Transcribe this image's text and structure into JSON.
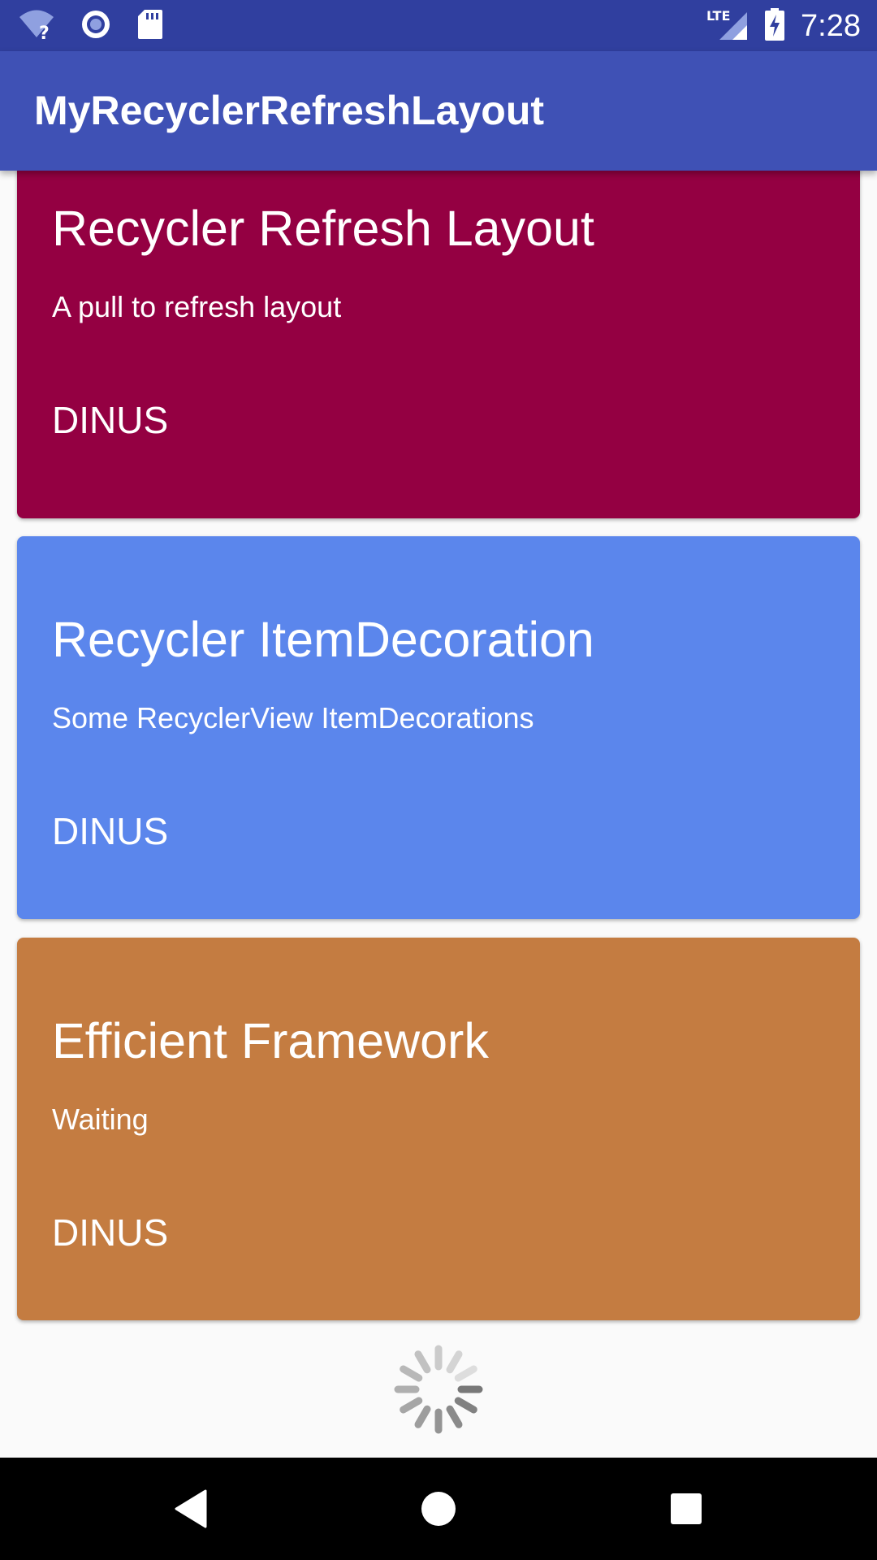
{
  "status_bar": {
    "time": "7:28",
    "icons": [
      "wifi-unknown-icon",
      "sync-icon",
      "sd-card-icon",
      "lte-signal-icon",
      "battery-charging-icon"
    ],
    "network_label": "LTE"
  },
  "app_bar": {
    "title": "MyRecyclerRefreshLayout",
    "color": "#3f51b5"
  },
  "cards": [
    {
      "title": "Recycler Refresh Layout",
      "subtitle": "A pull to refresh layout",
      "author": "DINUS",
      "color": "#940042"
    },
    {
      "title": "Recycler ItemDecoration",
      "subtitle": "Some RecyclerView ItemDecorations",
      "author": "DINUS",
      "color": "#5b86ec"
    },
    {
      "title": "Efficient Framework",
      "subtitle": "Waiting",
      "author": "DINUS",
      "color": "#c47c41"
    }
  ],
  "loading_indicator": "spinner-icon",
  "nav_bar": {
    "icons": [
      "back-icon",
      "home-icon",
      "recents-icon"
    ]
  }
}
